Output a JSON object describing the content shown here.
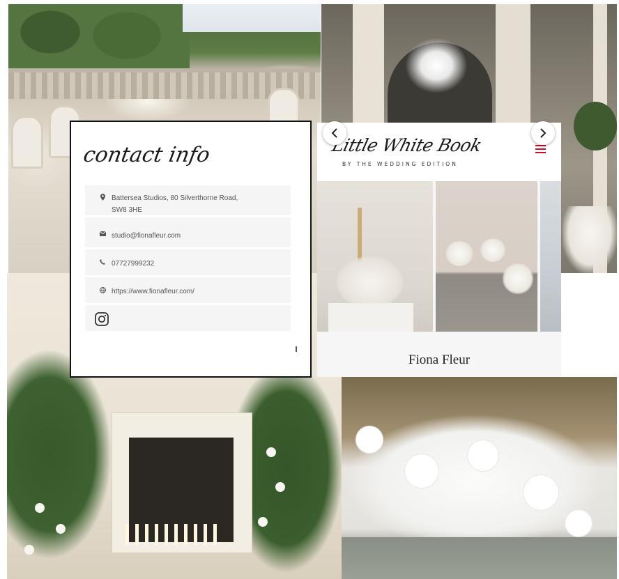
{
  "contact": {
    "title": "contact info",
    "address": "Battersea Studios, 80 Silverthorne Road,\nSW8 3HE",
    "email": "studio@fionafleur.com",
    "phone": "07727999232",
    "website": "https://www.fionafleur.com/"
  },
  "listing": {
    "logo": "Little White Book",
    "tagline": "BY THE WEDDING EDITION",
    "name": "Fiona Fleur"
  },
  "icons": {
    "location": "location-pin-icon",
    "email": "envelope-icon",
    "phone": "phone-icon",
    "website": "globe-icon",
    "instagram": "instagram-icon",
    "menu": "hamburger-menu-icon",
    "prev": "chevron-left-icon",
    "next": "chevron-right-icon"
  },
  "colors": {
    "menu_accent": "#c8102e",
    "text_muted": "#555555",
    "row_background": "#f5f5f5"
  }
}
